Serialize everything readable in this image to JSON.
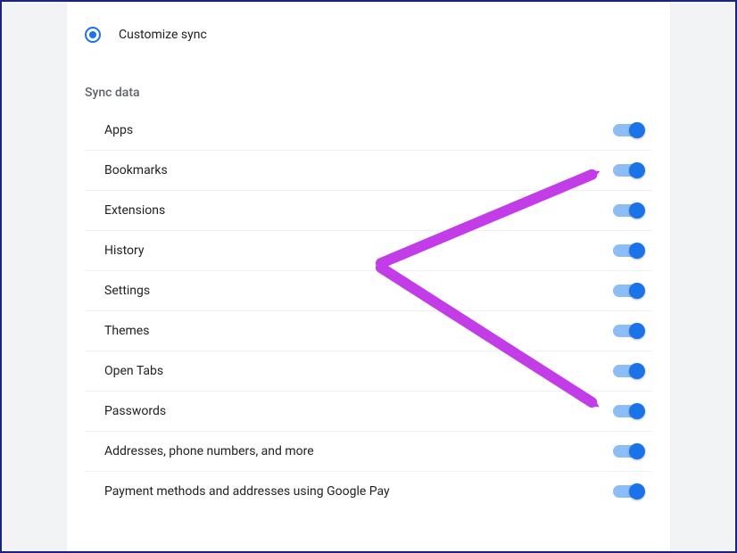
{
  "radio": {
    "customize_label": "Customize sync",
    "selected": true
  },
  "section_header": "Sync data",
  "sync_items": [
    {
      "label": "Apps",
      "enabled": true
    },
    {
      "label": "Bookmarks",
      "enabled": true
    },
    {
      "label": "Extensions",
      "enabled": true
    },
    {
      "label": "History",
      "enabled": true
    },
    {
      "label": "Settings",
      "enabled": true
    },
    {
      "label": "Themes",
      "enabled": true
    },
    {
      "label": "Open Tabs",
      "enabled": true
    },
    {
      "label": "Passwords",
      "enabled": true
    },
    {
      "label": "Addresses, phone numbers, and more",
      "enabled": true
    },
    {
      "label": "Payment methods and addresses using Google Pay",
      "enabled": true
    }
  ],
  "annotation": {
    "color": "#c23ce8"
  }
}
